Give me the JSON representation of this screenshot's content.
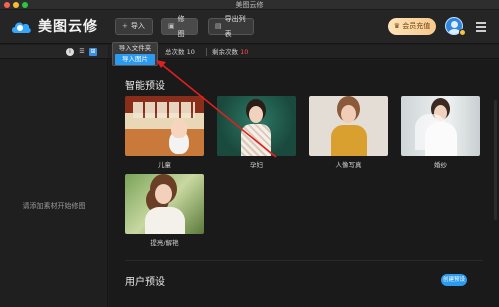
{
  "window": {
    "title": "美图云修"
  },
  "app": {
    "name": "美图云修"
  },
  "toolbar": {
    "import_label": "导入",
    "edit_label": "修图",
    "export_label": "导出列表",
    "vip_label": "会员充值"
  },
  "dropdown": {
    "items": [
      {
        "label": "导入文件夹"
      },
      {
        "label": "导入图片"
      }
    ]
  },
  "stats": {
    "total_label": "总次数",
    "total_value": "10",
    "remaining_label": "剩余次数",
    "remaining_value": "10"
  },
  "left_panel": {
    "hint": "请添加素材开始修图"
  },
  "smart_presets": {
    "title": "智能预设",
    "items": [
      {
        "label": "儿童"
      },
      {
        "label": "孕妇"
      },
      {
        "label": "人像写真"
      },
      {
        "label": "婚纱"
      },
      {
        "label": "提亮/解艳"
      }
    ]
  },
  "user_presets": {
    "title": "用户预设",
    "new_button": "创建预设"
  },
  "colors": {
    "accent": "#2a9bf0",
    "highlight_red": "#ff4d4f",
    "vip_gold": "#f7c98b"
  }
}
